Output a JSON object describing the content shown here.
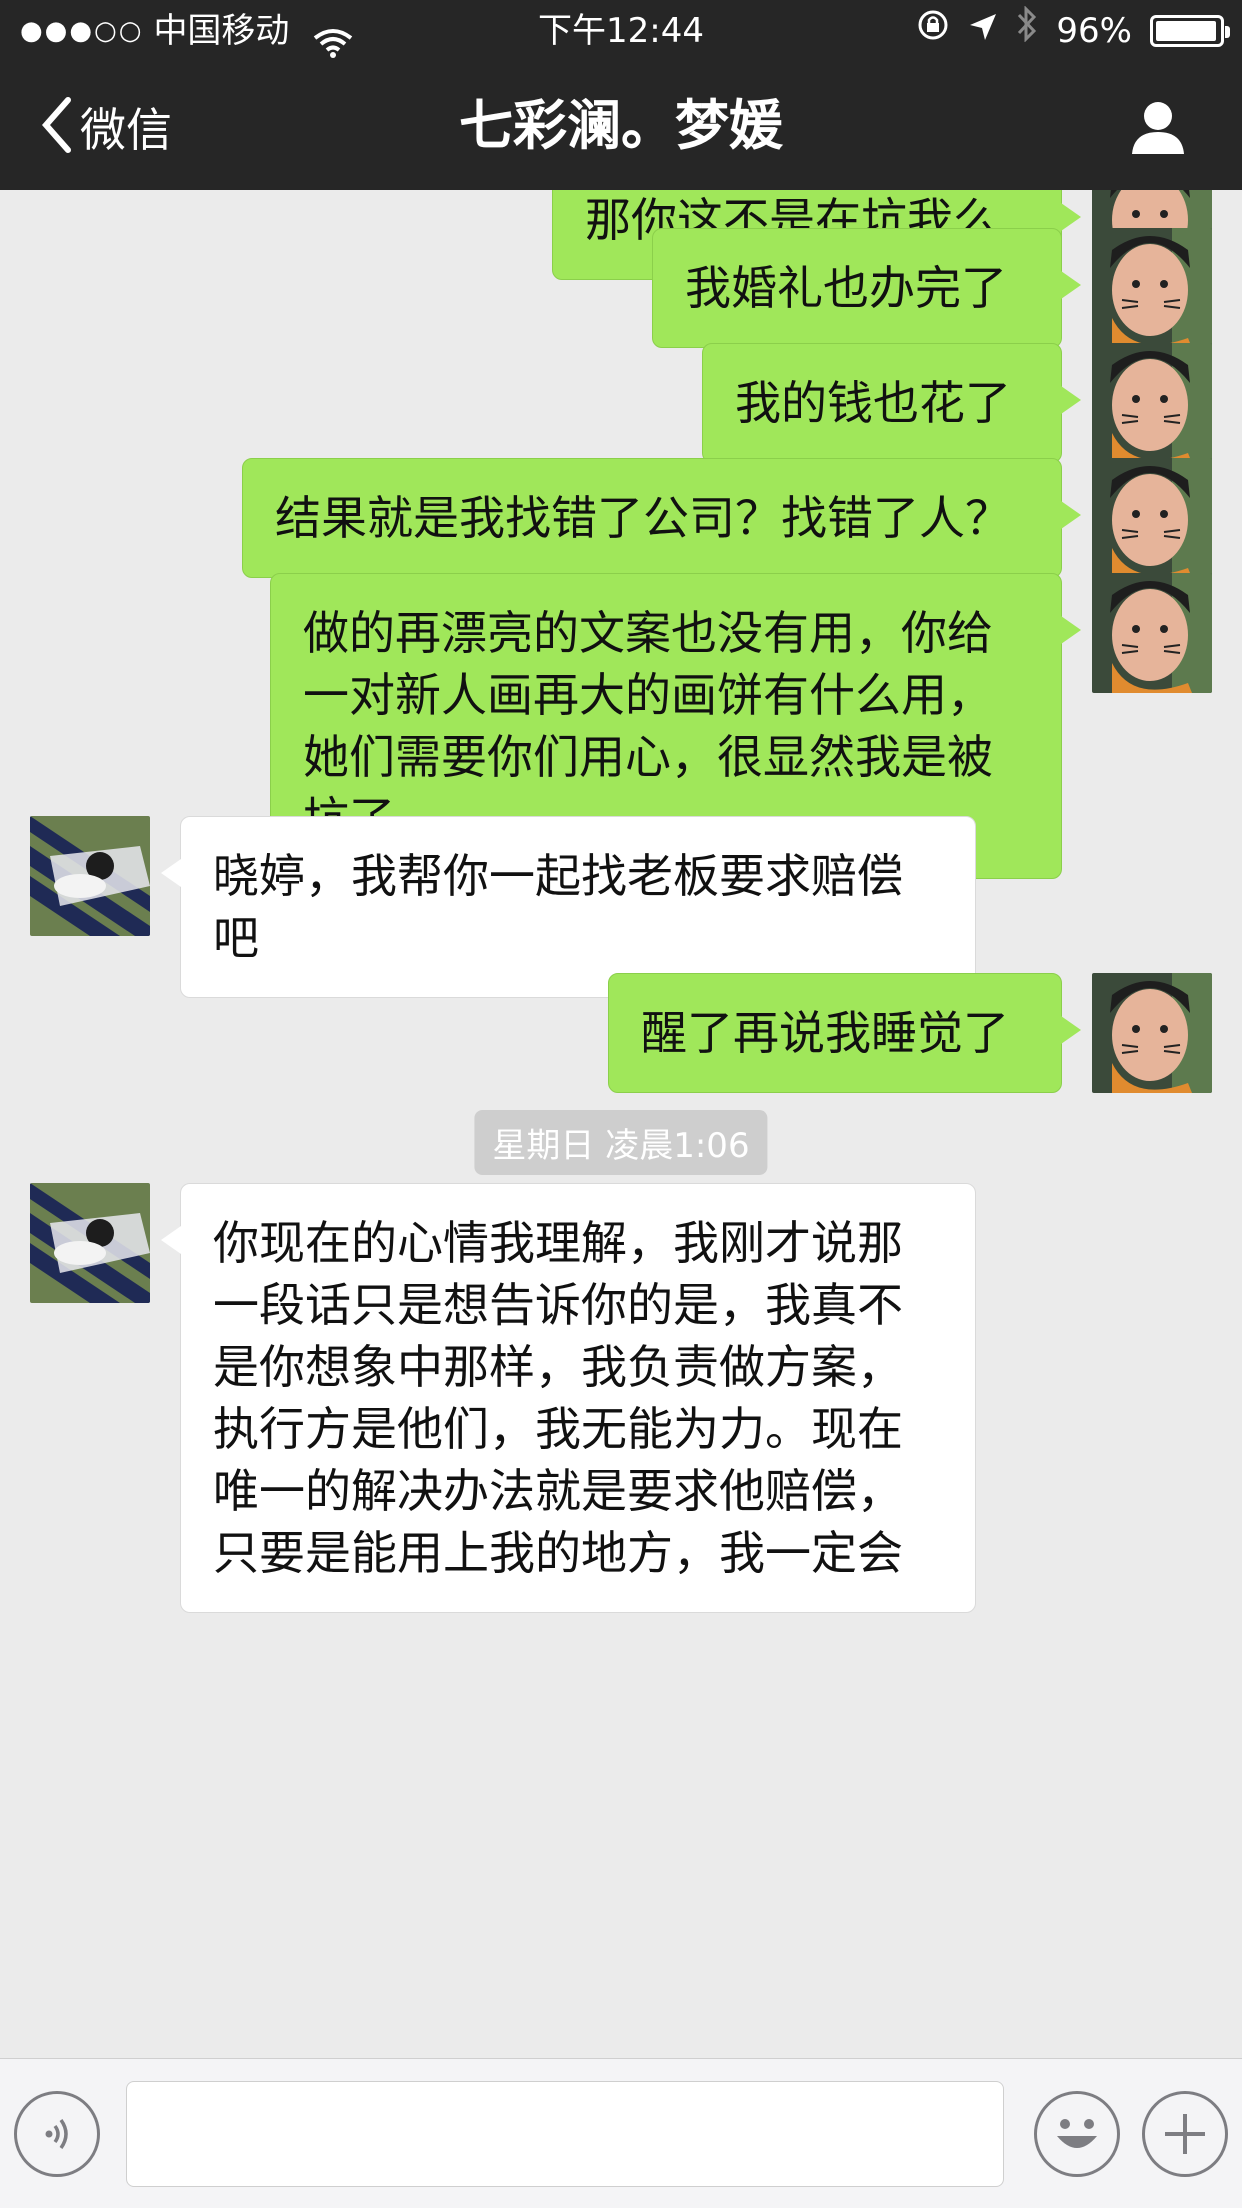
{
  "status_bar": {
    "signal": "●●●○○",
    "carrier": "中国移动",
    "time": "下午12:44",
    "battery": "96%",
    "battery_level": 0.96
  },
  "nav": {
    "back_label": "微信",
    "title": "七彩澜。梦媛"
  },
  "messages": [
    {
      "side": "me",
      "text": "那你这不是在坑我么"
    },
    {
      "side": "me",
      "text": "我婚礼也办完了"
    },
    {
      "side": "me",
      "text": "我的钱也花了"
    },
    {
      "side": "me",
      "text": "结果就是我找错了公司？找错了人？"
    },
    {
      "side": "me",
      "text": "做的再漂亮的文案也没有用，你给\n一对新人画再大的画饼有什么用，\n她们需要你们用心，很显然我是被\n坑了……"
    },
    {
      "side": "other",
      "text": "晓婷，我帮你一起找老板要求赔偿\n吧"
    },
    {
      "side": "me",
      "text": "醒了再说我睡觉了"
    },
    {
      "side": "other",
      "text": "你现在的心情我理解，我刚才说那\n一段话只是想告诉你的是，我真不\n是你想象中那样，我负责做方案，\n执行方是他们，我无能为力。现在\n唯一的解决办法就是要求他赔偿，\n只要是能用上我的地方，我一定会"
    }
  ],
  "timestamp": "星期日 凌晨1:06",
  "input": {
    "value": "",
    "placeholder": ""
  },
  "colors": {
    "header_bg": "#262626",
    "chat_bg": "#ebebeb",
    "bubble_me": "#a0e75a",
    "bubble_other": "#ffffff",
    "timestamp_bg": "#cecece"
  },
  "icons": {
    "back": "chevron-left-icon",
    "profile": "person-icon",
    "wifi": "wifi-icon",
    "location": "location-arrow-icon",
    "bluetooth": "bluetooth-icon",
    "lock": "orientation-lock-icon",
    "voice": "voice-icon",
    "emoji": "emoji-icon",
    "add": "plus-icon"
  }
}
